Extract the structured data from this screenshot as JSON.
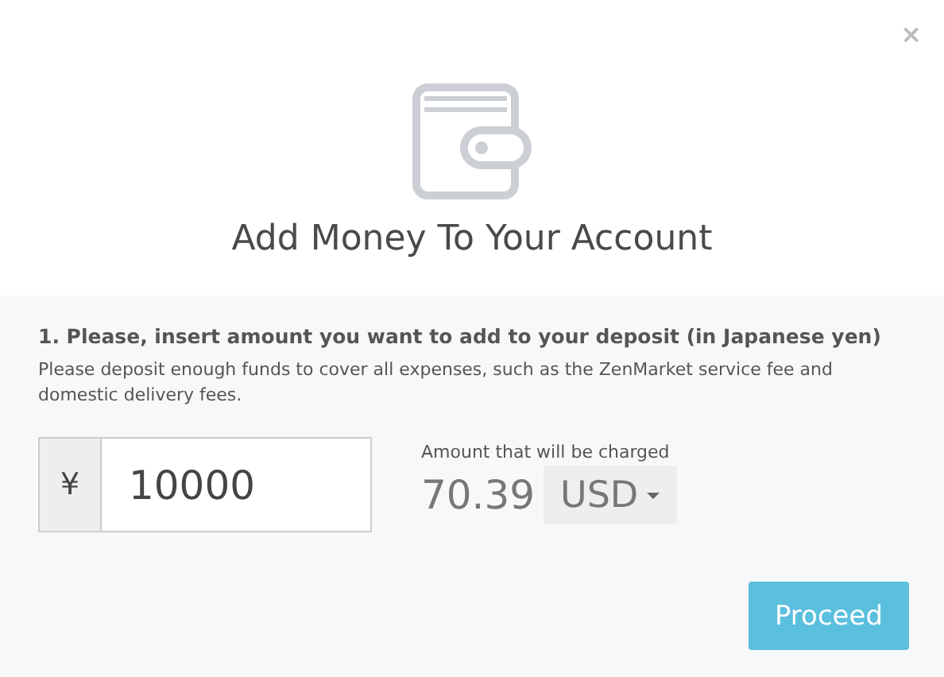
{
  "dialog": {
    "close": "×",
    "title": "Add Money To Your Account"
  },
  "step": {
    "heading": "1. Please, insert amount you want to add to your deposit (in Japanese yen)",
    "description": "Please deposit enough funds to cover all expenses, such as the ZenMarket service fee and domestic delivery fees."
  },
  "amount_field": {
    "prefix": "¥",
    "value": "10000"
  },
  "charge": {
    "label": "Amount that will be charged",
    "amount": "70.39",
    "currency": "USD"
  },
  "buttons": [
    "Proceed"
  ]
}
